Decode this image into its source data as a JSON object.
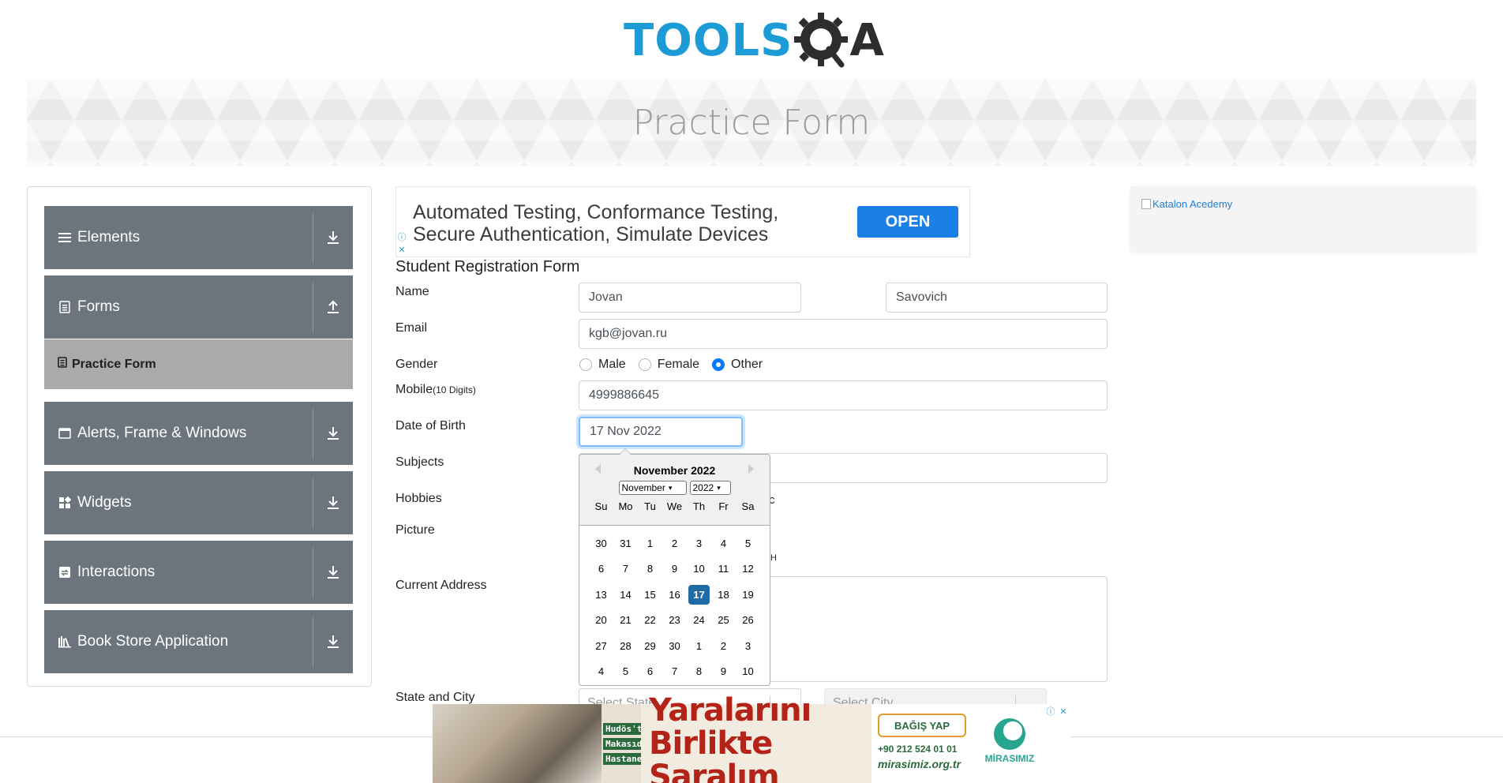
{
  "logo": {
    "tools": "TOOLS",
    "a": "A"
  },
  "banner": {
    "title": "Practice Form"
  },
  "sidebar": {
    "groups": [
      {
        "label": "Elements",
        "icon": "list-icon",
        "arrow": "download-icon"
      },
      {
        "label": "Forms",
        "icon": "document-icon",
        "arrow": "upload-icon"
      },
      {
        "label": "Alerts, Frame & Windows",
        "icon": "window-icon",
        "arrow": "download-icon"
      },
      {
        "label": "Widgets",
        "icon": "widgets-icon",
        "arrow": "download-icon"
      },
      {
        "label": "Interactions",
        "icon": "interactions-icon",
        "arrow": "download-icon"
      },
      {
        "label": "Book Store Application",
        "icon": "book-store-icon",
        "arrow": "download-icon"
      }
    ],
    "active_item": "Practice Form"
  },
  "ad_top": {
    "line1": "Automated Testing, Conformance Testing,",
    "line2": "Secure Authentication, Simulate Devices",
    "button": "OPEN"
  },
  "form": {
    "title": "Student Registration Form",
    "labels": {
      "name": "Name",
      "email": "Email",
      "gender": "Gender",
      "mobile": "Mobile",
      "mobile_hint": "(10 Digits)",
      "dob": "Date of Birth",
      "subjects": "Subjects",
      "hobbies": "Hobbies",
      "picture": "Picture",
      "address": "Current Address",
      "state_city": "State and City"
    },
    "first_name": "Jovan",
    "last_name": "Savovich",
    "email": "kgb@jovan.ru",
    "gender_options": [
      "Male",
      "Female",
      "Other"
    ],
    "gender_selected": "Other",
    "mobile": "4999886645",
    "dob": "17 Nov 2022",
    "state_placeholder": "Select State",
    "city_placeholder": "Select City",
    "hobby_fragment": "c",
    "picture_fragment": "H"
  },
  "datepicker": {
    "month_title": "November 2022",
    "month_select": "November",
    "year_select": "2022",
    "days_of_week": [
      "Su",
      "Mo",
      "Tu",
      "We",
      "Th",
      "Fr",
      "Sa"
    ],
    "weeks": [
      [
        "30",
        "31",
        "1",
        "2",
        "3",
        "4",
        "5"
      ],
      [
        "6",
        "7",
        "8",
        "9",
        "10",
        "11",
        "12"
      ],
      [
        "13",
        "14",
        "15",
        "16",
        "17",
        "18",
        "19"
      ],
      [
        "20",
        "21",
        "22",
        "23",
        "24",
        "25",
        "26"
      ],
      [
        "27",
        "28",
        "29",
        "30",
        "1",
        "2",
        "3"
      ],
      [
        "4",
        "5",
        "6",
        "7",
        "8",
        "9",
        "10"
      ]
    ],
    "selected_day": "17"
  },
  "ad_side": {
    "alt_text": "Katalon Acedemy"
  },
  "ad_bottom": {
    "small1": "Hudös'teki",
    "small2": "Makasıd",
    "small3": "Hastanesinin",
    "headline1": "Yaralarını",
    "headline2": "Birlikte Saralım",
    "donate": "BAĞIŞ YAP",
    "phone": "+90 212 524 01 01",
    "site": "mirasimiz.org.tr",
    "brand": "MİRASIMIZ"
  },
  "colors": {
    "accent": "#1d9bd6",
    "sidebar_bg": "#6c757d",
    "active_bg": "#aaaaaa",
    "selected_day": "#216ba5",
    "radio_checked": "#007bff"
  }
}
